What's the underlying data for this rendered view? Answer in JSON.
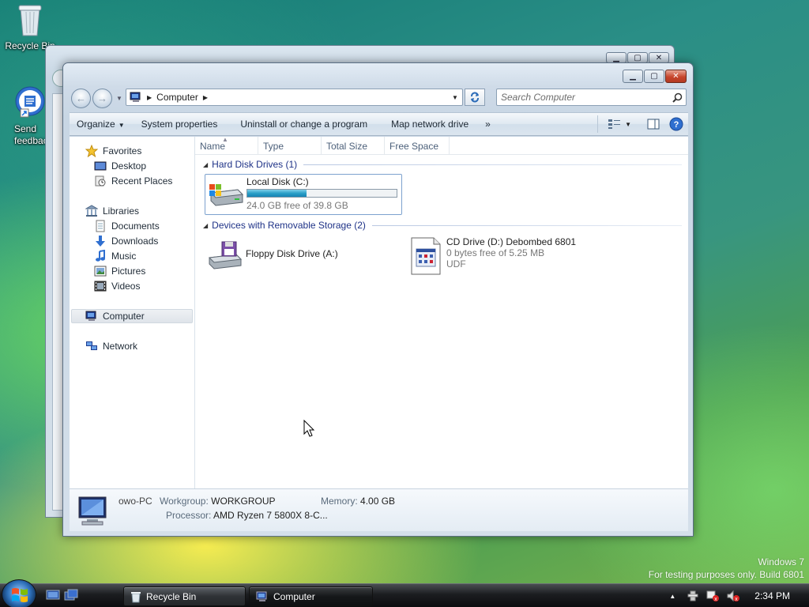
{
  "desktop": {
    "icons": [
      {
        "label": "Recycle Bin",
        "icon": "recycle-bin-icon"
      },
      {
        "label": "Send feedback",
        "icon": "feedback-icon"
      }
    ],
    "watermark": {
      "line1": "Windows 7",
      "line2": "For testing purposes only. Build 6801"
    }
  },
  "window": {
    "caption_buttons": {
      "minimize": "minimize-icon",
      "maximize": "maximize-icon",
      "close": "close-icon"
    },
    "address": {
      "location": "Computer"
    },
    "search": {
      "placeholder": "Search Computer"
    },
    "toolbar": {
      "organize": "Organize",
      "system_properties": "System properties",
      "uninstall": "Uninstall or change a program",
      "map_drive": "Map network drive",
      "more": "»"
    },
    "nav": {
      "favorites": "Favorites",
      "desktop": "Desktop",
      "recent_places": "Recent Places",
      "libraries": "Libraries",
      "documents": "Documents",
      "downloads": "Downloads",
      "music": "Music",
      "pictures": "Pictures",
      "videos": "Videos",
      "computer": "Computer",
      "network": "Network"
    },
    "columns": [
      "Name",
      "Type",
      "Total Size",
      "Free Space"
    ],
    "groups": {
      "hdd": "Hard Disk Drives (1)",
      "removable": "Devices with Removable Storage (2)"
    },
    "drives": {
      "c": {
        "name": "Local Disk (C:)",
        "free": "24.0 GB free of 39.8 GB",
        "used_fraction": 0.397
      },
      "a": {
        "name": "Floppy Disk Drive (A:)"
      },
      "d": {
        "name": "CD Drive (D:) Debombed 6801",
        "free": "0 bytes free of 5.25 MB",
        "fs": "UDF"
      }
    },
    "details": {
      "computer_name": "owo-PC",
      "workgroup_label": "Workgroup:",
      "workgroup": "WORKGROUP",
      "memory_label": "Memory:",
      "memory": "4.00 GB",
      "processor_label": "Processor:",
      "processor": "AMD Ryzen 7 5800X 8-C..."
    }
  },
  "taskbar": {
    "buttons": [
      {
        "label": "Recycle Bin",
        "active": false
      },
      {
        "label": "Computer",
        "active": true
      }
    ],
    "clock": "2:34 PM"
  },
  "colors": {
    "accent": "#1e3287",
    "selection_border": "#7da2ce",
    "bar_fill": "#2a9fc8"
  }
}
